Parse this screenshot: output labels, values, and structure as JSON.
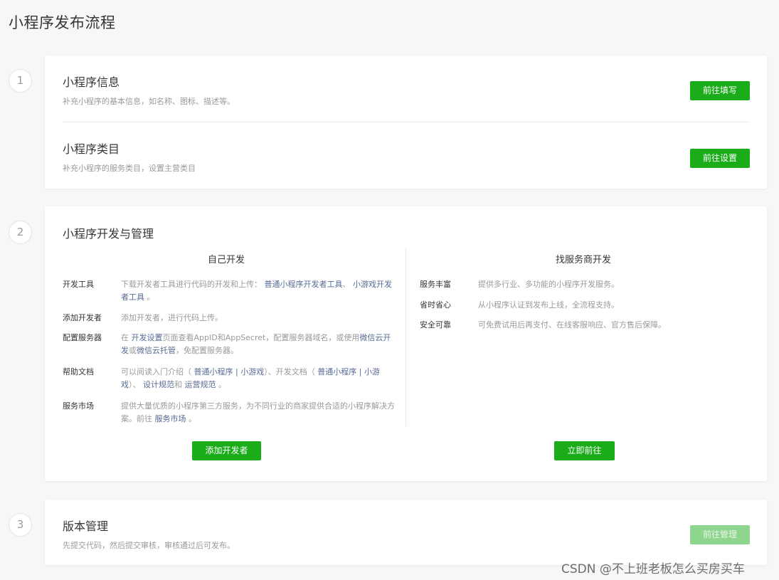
{
  "page": {
    "title": "小程序发布流程"
  },
  "steps": [
    "1",
    "2",
    "3"
  ],
  "card1": {
    "info": {
      "title": "小程序信息",
      "desc": "补充小程序的基本信息，如名称、图标、描述等。",
      "button": "前往填写"
    },
    "category": {
      "title": "小程序类目",
      "desc": "补充小程序的服务类目，设置主营类目",
      "button": "前往设置"
    }
  },
  "card2": {
    "title": "小程序开发与管理",
    "self": {
      "title": "自己开发",
      "tools": {
        "label": "开发工具",
        "text1": "下载开发者工具进行代码的开发和上传：",
        "link1": "普通小程序开发者工具",
        "sep": "、",
        "link2": "小游戏开发者工具",
        "end": "。"
      },
      "add_dev": {
        "label": "添加开发者",
        "text": "添加开发者，进行代码上传。"
      },
      "server": {
        "label": "配置服务器",
        "text1": "在",
        "link1": "开发设置",
        "text2": "页面查看AppID和AppSecret，配置服务器域名，或使用",
        "link2": "微信云开发",
        "text3": "或",
        "link3": "微信云托管",
        "text4": "，免配置服务器。"
      },
      "docs": {
        "label": "帮助文档",
        "text1": "可以阅读入门介绍（",
        "link1": "普通小程序",
        "sep1": "|",
        "link2": "小游戏",
        "text2": "）、开发文档（",
        "link3": "普通小程序",
        "sep2": "|",
        "link4": "小游戏",
        "text3": "）、",
        "link5": "设计规范",
        "text4": "和",
        "link6": "运营规范",
        "end": "。"
      },
      "market": {
        "label": "服务市场",
        "text1": "提供大量优质的小程序第三方服务，为不同行业的商家提供合适的小程序解决方案。前往",
        "link1": "服务市场",
        "end": "。"
      },
      "button": "添加开发者"
    },
    "provider": {
      "title": "找服务商开发",
      "rich": {
        "label": "服务丰富",
        "text": "提供多行业、多功能的小程序开发服务。"
      },
      "save": {
        "label": "省时省心",
        "text": "从小程序认证到发布上线，全流程支持。"
      },
      "safe": {
        "label": "安全可靠",
        "text": "可免费试用后再支付、在线客服响应、官方售后保障。"
      },
      "button": "立即前往"
    }
  },
  "card3": {
    "title": "版本管理",
    "desc": "先提交代码，然后提交审核，审核通过后可发布。",
    "button": "前往管理"
  },
  "watermark": "CSDN @不上班老板怎么买房买车",
  "colors": {
    "primary": "#1aad19",
    "primary_disabled": "#8ed58d",
    "link": "#576b95",
    "muted": "#9a9a9a"
  }
}
